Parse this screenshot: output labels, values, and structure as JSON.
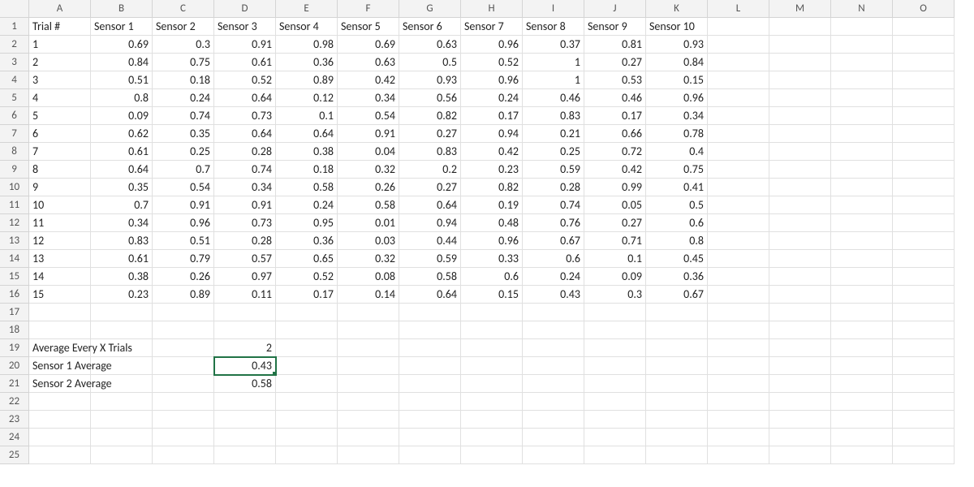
{
  "columns": [
    "A",
    "B",
    "C",
    "D",
    "E",
    "F",
    "G",
    "H",
    "I",
    "J",
    "K",
    "L",
    "M",
    "N",
    "O"
  ],
  "row_count": 25,
  "selected_cell": "D20",
  "headers": {
    "A": "Trial #",
    "B": "Sensor 1",
    "C": "Sensor 2",
    "D": "Sensor 3",
    "E": "Sensor 4",
    "F": "Sensor 5",
    "G": "Sensor 6",
    "H": "Sensor 7",
    "I": "Sensor 8",
    "J": "Sensor 9",
    "K": "Sensor 10"
  },
  "trials": [
    {
      "n": "1",
      "v": [
        "0.69",
        "0.3",
        "0.91",
        "0.98",
        "0.69",
        "0.63",
        "0.96",
        "0.37",
        "0.81",
        "0.93"
      ]
    },
    {
      "n": "2",
      "v": [
        "0.84",
        "0.75",
        "0.61",
        "0.36",
        "0.63",
        "0.5",
        "0.52",
        "1",
        "0.27",
        "0.84"
      ]
    },
    {
      "n": "3",
      "v": [
        "0.51",
        "0.18",
        "0.52",
        "0.89",
        "0.42",
        "0.93",
        "0.96",
        "1",
        "0.53",
        "0.15"
      ]
    },
    {
      "n": "4",
      "v": [
        "0.8",
        "0.24",
        "0.64",
        "0.12",
        "0.34",
        "0.56",
        "0.24",
        "0.46",
        "0.46",
        "0.96"
      ]
    },
    {
      "n": "5",
      "v": [
        "0.09",
        "0.74",
        "0.73",
        "0.1",
        "0.54",
        "0.82",
        "0.17",
        "0.83",
        "0.17",
        "0.34"
      ]
    },
    {
      "n": "6",
      "v": [
        "0.62",
        "0.35",
        "0.64",
        "0.64",
        "0.91",
        "0.27",
        "0.94",
        "0.21",
        "0.66",
        "0.78"
      ]
    },
    {
      "n": "7",
      "v": [
        "0.61",
        "0.25",
        "0.28",
        "0.38",
        "0.04",
        "0.83",
        "0.42",
        "0.25",
        "0.72",
        "0.4"
      ]
    },
    {
      "n": "8",
      "v": [
        "0.64",
        "0.7",
        "0.74",
        "0.18",
        "0.32",
        "0.2",
        "0.23",
        "0.59",
        "0.42",
        "0.75"
      ]
    },
    {
      "n": "9",
      "v": [
        "0.35",
        "0.54",
        "0.34",
        "0.58",
        "0.26",
        "0.27",
        "0.82",
        "0.28",
        "0.99",
        "0.41"
      ]
    },
    {
      "n": "10",
      "v": [
        "0.7",
        "0.91",
        "0.91",
        "0.24",
        "0.58",
        "0.64",
        "0.19",
        "0.74",
        "0.05",
        "0.5"
      ]
    },
    {
      "n": "11",
      "v": [
        "0.34",
        "0.96",
        "0.73",
        "0.95",
        "0.01",
        "0.94",
        "0.48",
        "0.76",
        "0.27",
        "0.6"
      ]
    },
    {
      "n": "12",
      "v": [
        "0.83",
        "0.51",
        "0.28",
        "0.36",
        "0.03",
        "0.44",
        "0.96",
        "0.67",
        "0.71",
        "0.8"
      ]
    },
    {
      "n": "13",
      "v": [
        "0.61",
        "0.79",
        "0.57",
        "0.65",
        "0.32",
        "0.59",
        "0.33",
        "0.6",
        "0.1",
        "0.45"
      ]
    },
    {
      "n": "14",
      "v": [
        "0.38",
        "0.26",
        "0.97",
        "0.52",
        "0.08",
        "0.58",
        "0.6",
        "0.24",
        "0.09",
        "0.36"
      ]
    },
    {
      "n": "15",
      "v": [
        "0.23",
        "0.89",
        "0.11",
        "0.17",
        "0.14",
        "0.64",
        "0.15",
        "0.43",
        "0.3",
        "0.67"
      ]
    }
  ],
  "summary": {
    "row19_label": "Average Every X Trials",
    "row19_value": "2",
    "row20_label": "Sensor 1 Average",
    "row20_value": "0.43",
    "row21_label": "Sensor 2 Average",
    "row21_value": "0.58"
  }
}
